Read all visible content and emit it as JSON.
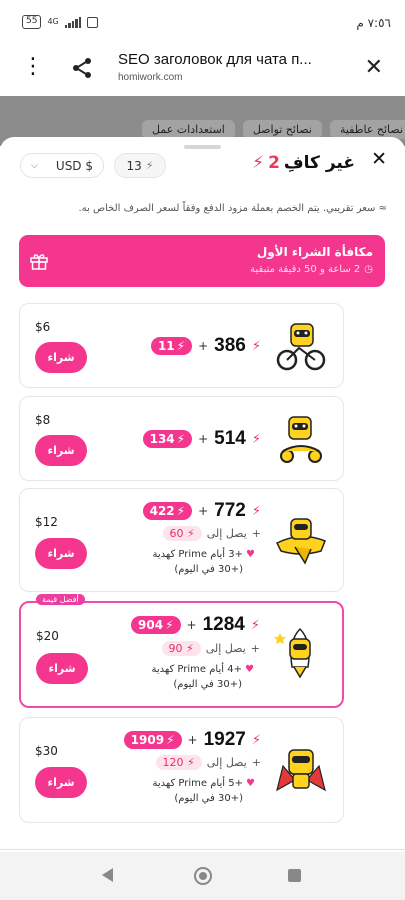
{
  "status_bar": {
    "time": "٧:٥٦ م",
    "battery": "55",
    "network": "4G"
  },
  "browser": {
    "title": "SEO заголовок для чата п...",
    "url": "homiwork.com"
  },
  "background_page": {
    "tabs": [
      "نصائح عاطفية",
      "نصائح تواصل",
      "استعدادات عمل"
    ]
  },
  "sheet": {
    "title": "غير كافِ",
    "title_count": "2",
    "currency": "USD $",
    "balance": "13",
    "note": "≈ سعر تقريبي. يتم الخصم بعملة مزود الدفع وفقاً لسعر الصرف الخاص به.",
    "promo": {
      "title": "مكافأة الشراء الأول",
      "timer": "2 ساعة و 50 دقيقة متبقية"
    },
    "best_label": "أفضل قيمة",
    "buy_label": "شراء",
    "upto_label": "يصل إلى",
    "packages": [
      {
        "price": "$6",
        "amount": "386",
        "bonus": "11"
      },
      {
        "price": "$8",
        "amount": "514",
        "bonus": "134"
      },
      {
        "price": "$12",
        "amount": "772",
        "bonus": "422",
        "upto": "60",
        "prime_line1": "+3 أيام Prime كهدية",
        "prime_line2": "(+30 في اليوم)"
      },
      {
        "price": "$20",
        "amount": "1284",
        "bonus": "904",
        "upto": "90",
        "prime_line1": "+4 أيام Prime كهدية",
        "prime_line2": "(+30 في اليوم)"
      },
      {
        "price": "$30",
        "amount": "1927",
        "bonus": "1909",
        "upto": "120",
        "prime_line1": "+5 أيام Prime كهدية",
        "prime_line2": "(+30 في اليوم)"
      }
    ]
  },
  "colors": {
    "accent": "#f4368f",
    "bolt": "#f0365f",
    "mascot": "#ffd21f"
  }
}
